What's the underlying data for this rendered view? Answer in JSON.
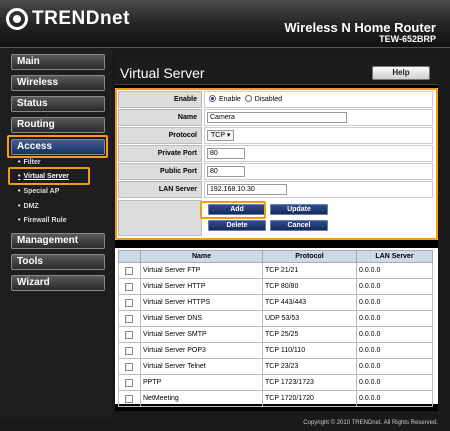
{
  "brand": {
    "name": "TRENDnet",
    "product": "Wireless N Home Router",
    "model": "TEW-652BRP",
    "highlight_color": "#f39c12"
  },
  "nav": {
    "main": "Main",
    "wireless": "Wireless",
    "status": "Status",
    "routing": "Routing",
    "access": "Access",
    "access_sub": {
      "filter": "Filter",
      "virtual_server": "Virtual Server",
      "special_ap": "Special AP",
      "dmz": "DMZ",
      "firewall_rule": "Firewall Rule"
    },
    "management": "Management",
    "tools": "Tools",
    "wizard": "Wizard"
  },
  "page": {
    "title": "Virtual Server",
    "help": "Help"
  },
  "form": {
    "enable_label": "Enable",
    "enable_option": "Enable",
    "disabled_option": "Disabled",
    "enable_selected": "Enable",
    "name_label": "Name",
    "name_value": "Camera",
    "protocol_label": "Protocol",
    "protocol_value": "TCP",
    "private_port_label": "Private Port",
    "private_port_value": "80",
    "public_port_label": "Public Port",
    "public_port_value": "80",
    "lan_server_label": "LAN Server",
    "lan_server_value": "192.168.10.30",
    "add_label": "Add",
    "update_label": "Update",
    "delete_label": "Delete",
    "cancel_label": "Cancel"
  },
  "table": {
    "headers": [
      "",
      "Name",
      "Protocol",
      "LAN Server"
    ],
    "rows": [
      [
        "Virtual Server FTP",
        "TCP 21/21",
        "0.0.0.0"
      ],
      [
        "Virtual Server HTTP",
        "TCP 80/80",
        "0.0.0.0"
      ],
      [
        "Virtual Server HTTPS",
        "TCP 443/443",
        "0.0.0.0"
      ],
      [
        "Virtual Server DNS",
        "UDP 53/53",
        "0.0.0.0"
      ],
      [
        "Virtual Server SMTP",
        "TCP 25/25",
        "0.0.0.0"
      ],
      [
        "Virtual Server POP3",
        "TCP 110/110",
        "0.0.0.0"
      ],
      [
        "Virtual Server Telnet",
        "TCP 23/23",
        "0.0.0.0"
      ],
      [
        "PPTP",
        "TCP 1723/1723",
        "0.0.0.0"
      ],
      [
        "NetMeeting",
        "TCP 1720/1720",
        "0.0.0.0"
      ]
    ]
  },
  "footer": "Copyright © 2010 TRENDnet. All Rights Reserved."
}
